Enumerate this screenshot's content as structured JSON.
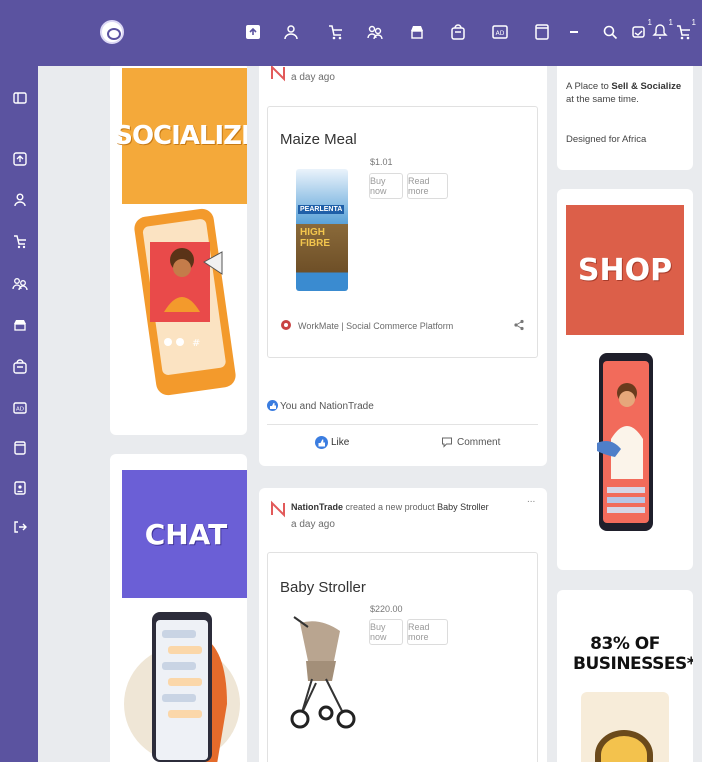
{
  "topbar": {
    "icons": [
      "home-icon",
      "user-icon",
      "cart-icon",
      "people-icon",
      "shop-icon",
      "bag-icon",
      "ad-icon",
      "page-icon",
      "minus-icon",
      "search-icon",
      "bell-icon",
      "chat-icon",
      "cart-badge-icon"
    ],
    "badges": [
      "1",
      "1",
      "1"
    ]
  },
  "sidebar": {
    "icons": [
      "sidebar-toggle-icon",
      "home-icon",
      "user-icon",
      "cart-icon",
      "people-icon",
      "shop-icon",
      "bag-icon",
      "ad-icon",
      "page-icon",
      "id-card-icon",
      "logout-icon"
    ]
  },
  "left_rail": {
    "socialize_title": "SOCIALIZE",
    "chat_title": "CHAT"
  },
  "feed": {
    "post1": {
      "time": "a day ago",
      "product_title": "Maize Meal",
      "price": "$1.01",
      "buy_now": "Buy now",
      "read_more": "Read more",
      "package_brand": "PEARLENTA",
      "package_text": "HIGH FIBRE",
      "shop_name": "WorkMate | Social Commerce Platform",
      "reactions": "You and NationTrade",
      "like_label": "Like",
      "comment_label": "Comment"
    },
    "post2": {
      "author": "NationTrade",
      "action": "created a new product",
      "product_link": "Baby Stroller",
      "time": "a day ago",
      "more": "...",
      "product_title": "Baby Stroller",
      "price": "$220.00",
      "buy_now": "Buy now",
      "read_more": "Read more"
    }
  },
  "right_rail": {
    "about_prefix": "A Place to ",
    "about_bold": "Sell & Socialize",
    "about_suffix": " at the same time.",
    "designed_for": "Designed for Africa",
    "shop_title": "SHOP",
    "stat_title": "83% OF BUSINESSES*"
  },
  "colors": {
    "brand": "#5b53a0",
    "socialize": "#f4a93a",
    "chat": "#6b5fd6",
    "shop": "#dc5f49",
    "like_blue": "#3b7de0"
  }
}
